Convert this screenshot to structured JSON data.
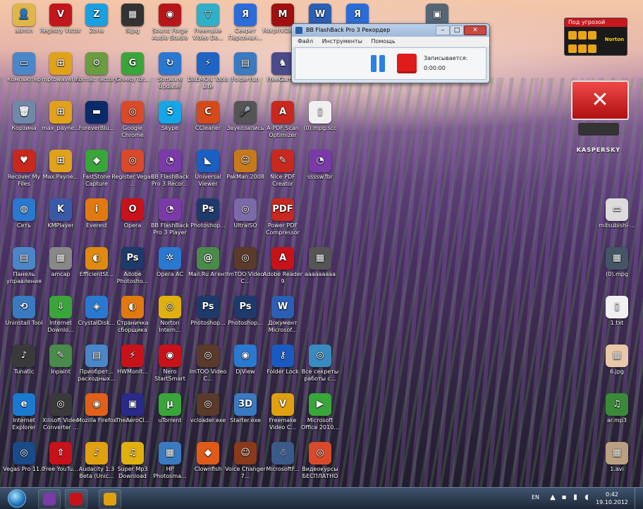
{
  "desktop": {
    "icons": [
      {
        "label": "admin",
        "glyph": "👤",
        "color": "#e0b64a"
      },
      {
        "label": "Registry Victor",
        "glyph": "V",
        "color": "#c2161c"
      },
      {
        "label": "Zona",
        "glyph": "Z",
        "color": "#1aa0e0"
      },
      {
        "label": "Sljpg",
        "glyph": "▦",
        "color": "#333333"
      },
      {
        "label": "Sound Forge Audio Studio",
        "glyph": "◉",
        "color": "#b8151b"
      },
      {
        "label": "Freemake Video Do...",
        "glyph": "▽",
        "color": "#2fb0c8"
      },
      {
        "label": "Секрет Персонал...",
        "glyph": "Я",
        "color": "#2c6cd8"
      },
      {
        "label": "MorphVOX Pro",
        "glyph": "M",
        "color": "#a01010"
      },
      {
        "label": "(1).doc",
        "glyph": "W",
        "color": "#2b5fb5"
      },
      {
        "label": "ЯТ",
        "glyph": "Я",
        "color": "#2c6cd8"
      },
      {
        "label": "1 - Copy",
        "glyph": "▣",
        "color": "#556677"
      },
      {
        "label": "Компьютер",
        "glyph": "▭",
        "color": "#4a86c8"
      },
      {
        "label": "mpfbwaverat",
        "glyph": "⊞",
        "color": "#e0a21b"
      },
      {
        "label": "Format Factory",
        "glyph": "⚙",
        "color": "#6a9c40"
      },
      {
        "label": "GreedyTor...",
        "glyph": "G",
        "color": "#3aa53a"
      },
      {
        "label": "Software Updater",
        "glyph": "↻",
        "color": "#2a79d0"
      },
      {
        "label": "DAEMON Tools Lite",
        "glyph": "⚡",
        "color": "#1f64c4"
      },
      {
        "label": "FolderFun",
        "glyph": "▤",
        "color": "#3a7ac0"
      },
      {
        "label": "FreeGames",
        "glyph": "♞",
        "color": "#4b4b8a"
      },
      {
        "label": "Корзина",
        "glyph": "🗑",
        "color": "#6f8aa8"
      },
      {
        "label": "max_payne...",
        "glyph": "⊞",
        "color": "#e0a21b"
      },
      {
        "label": "ForeverBlu...",
        "glyph": "▬",
        "color": "#0a2a6a"
      },
      {
        "label": "Google Chrome",
        "glyph": "◎",
        "color": "#d94a2b"
      },
      {
        "label": "Skype",
        "glyph": "S",
        "color": "#13a7e8"
      },
      {
        "label": "CCleaner",
        "glyph": "C",
        "color": "#d54a1a"
      },
      {
        "label": "Звукозапись",
        "glyph": "🎤",
        "color": "#555555"
      },
      {
        "label": "A-PDF Scan Optimizer",
        "glyph": "A",
        "color": "#c8281e"
      },
      {
        "label": "(0).mpg.scc",
        "glyph": "▯",
        "color": "#f0f0f0"
      },
      {
        "label": "Recover My Files",
        "glyph": "♥",
        "color": "#c8281e"
      },
      {
        "label": "Max.Payne...",
        "glyph": "⊞",
        "color": "#e0a21b"
      },
      {
        "label": "FastStone Capture",
        "glyph": "◆",
        "color": "#3aa53a"
      },
      {
        "label": "Register Vegas ...",
        "glyph": "◎",
        "color": "#d94a2b"
      },
      {
        "label": "BB FlashBack Pro 3 Recor...",
        "glyph": "◔",
        "color": "#7a3aa8"
      },
      {
        "label": "Universal Viewer",
        "glyph": "◣",
        "color": "#1a60c0"
      },
      {
        "label": "PakMan 2008",
        "glyph": "☺",
        "color": "#c87a1a"
      },
      {
        "label": "Nice PDF Creator",
        "glyph": "✎",
        "color": "#c8281e"
      },
      {
        "label": "ssssw.fbr",
        "glyph": "◔",
        "color": "#7a3aa8"
      },
      {
        "label": "Сеть",
        "glyph": "◍",
        "color": "#2a79d0"
      },
      {
        "label": "KMPlayer",
        "glyph": "K",
        "color": "#3a5aa8"
      },
      {
        "label": "Everest",
        "glyph": "i",
        "color": "#e07a10"
      },
      {
        "label": "Opera",
        "glyph": "O",
        "color": "#c8121a"
      },
      {
        "label": "BB FlashBack Pro 3 Player",
        "glyph": "◔",
        "color": "#7a3aa8"
      },
      {
        "label": "Photoshop...",
        "glyph": "Ps",
        "color": "#1e3a6a"
      },
      {
        "label": "UltraISO",
        "glyph": "◎",
        "color": "#7a6aa8"
      },
      {
        "label": "Power PDF Compressor",
        "glyph": "PDF",
        "color": "#c8281e"
      },
      {
        "label": "mitsubishi-...",
        "glyph": "▭",
        "color": "#dcdcdc"
      },
      {
        "label": "Панель управления",
        "glyph": "▤",
        "color": "#4a86c8"
      },
      {
        "label": "amcap",
        "glyph": "▦",
        "color": "#888888"
      },
      {
        "label": "EfficientSt...",
        "glyph": "◐",
        "color": "#e08a10"
      },
      {
        "label": "Adobe Photosho...",
        "glyph": "Ps",
        "color": "#1e3a6a"
      },
      {
        "label": "Opera AC",
        "glyph": "✲",
        "color": "#2a79d0"
      },
      {
        "label": "Mail.Ru Агент",
        "glyph": "@",
        "color": "#4a8a4a"
      },
      {
        "label": "ImTOO Video C...",
        "glyph": "◎",
        "color": "#5a3a2a"
      },
      {
        "label": "Adobe Reader 9",
        "glyph": "A",
        "color": "#c8121a"
      },
      {
        "label": "ааааааааа",
        "glyph": "▦",
        "color": "#555555"
      },
      {
        "label": "(0).mpg",
        "glyph": "▦",
        "color": "#445566"
      },
      {
        "label": "Uninstall Tool",
        "glyph": "⟲",
        "color": "#3a7ac0"
      },
      {
        "label": "Internet Downlo...",
        "glyph": "⇩",
        "color": "#3aa53a"
      },
      {
        "label": "CrystalDisk...",
        "glyph": "◈",
        "color": "#2a79d0"
      },
      {
        "label": "Страничка сборщика",
        "glyph": "◐",
        "color": "#e07a10"
      },
      {
        "label": "Norton Intern...",
        "glyph": "◎",
        "color": "#e0b010"
      },
      {
        "label": "Photoshop...",
        "glyph": "Ps",
        "color": "#1e3a6a"
      },
      {
        "label": "Photoshop...",
        "glyph": "Ps",
        "color": "#1e3a6a"
      },
      {
        "label": "Документ Microsof...",
        "glyph": "W",
        "color": "#2b5fb5"
      },
      {
        "label": "1.txt",
        "glyph": "▯",
        "color": "#f0f0f0"
      },
      {
        "label": "Tunatic",
        "glyph": "♪",
        "color": "#3a3a3a"
      },
      {
        "label": "Inpaint",
        "glyph": "✎",
        "color": "#4a8a4a"
      },
      {
        "label": "Приобрет... расходных...",
        "glyph": "▤",
        "color": "#4a86c8"
      },
      {
        "label": "HWMonit...",
        "glyph": "⚡",
        "color": "#c8121a"
      },
      {
        "label": "Nero StartSmart",
        "glyph": "◉",
        "color": "#c8121a"
      },
      {
        "label": "ImTOO Video C...",
        "glyph": "◎",
        "color": "#5a3a2a"
      },
      {
        "label": "DjView",
        "glyph": "◉",
        "color": "#2a79d0"
      },
      {
        "label": "Folder Lock",
        "glyph": "⚷",
        "color": "#1a5ac0"
      },
      {
        "label": "Все секреты работы с...",
        "glyph": "◎",
        "color": "#3a8ac0"
      },
      {
        "label": "6.jpg",
        "glyph": "▦",
        "color": "#e8c8a8"
      },
      {
        "label": "Internet Explorer",
        "glyph": "e",
        "color": "#1a7ad0"
      },
      {
        "label": "Xilisoft Video Converter ...",
        "glyph": "◎",
        "color": "#3a3a3a"
      },
      {
        "label": "Mozilla Firefox",
        "glyph": "◉",
        "color": "#e0601a"
      },
      {
        "label": "TheAeroCl...",
        "glyph": "▣",
        "color": "#2a2a8a"
      },
      {
        "label": "uTorrent",
        "glyph": "µ",
        "color": "#3aa53a"
      },
      {
        "label": "vcloader.exe",
        "glyph": "◎",
        "color": "#5a3a2a"
      },
      {
        "label": "Starter.exe",
        "glyph": "3D",
        "color": "#3a7ac0"
      },
      {
        "label": "Freemake Video C...",
        "glyph": "V",
        "color": "#e0a010"
      },
      {
        "label": "Microsoft Office 2010...",
        "glyph": "▶",
        "color": "#3aa53a"
      },
      {
        "label": "ar.mp3",
        "glyph": "♫",
        "color": "#3a8a3a"
      },
      {
        "label": "Vegas Pro 11.0",
        "glyph": "◎",
        "color": "#1a4a8a"
      },
      {
        "label": "Free YouTu...",
        "glyph": "⇧",
        "color": "#c8121a"
      },
      {
        "label": "Audacity 1.3 Beta (Unic...",
        "glyph": "♪",
        "color": "#e0a010"
      },
      {
        "label": "Super Mp3 Download",
        "glyph": "♫",
        "color": "#e0b010"
      },
      {
        "label": "HP Photosma...",
        "glyph": "▦",
        "color": "#3a7ac0"
      },
      {
        "label": "Clownfish",
        "glyph": "◆",
        "color": "#e05a1a"
      },
      {
        "label": "Voice Changer 7...",
        "glyph": "☺",
        "color": "#8a3a1a"
      },
      {
        "label": "MicrosoftF...",
        "glyph": "☃",
        "color": "#3a5a8a"
      },
      {
        "label": "Видеокурсы БЕСПЛАТНО",
        "glyph": "◎",
        "color": "#d94a2b"
      },
      {
        "label": "1.avi",
        "glyph": "▦",
        "color": "#bba080"
      }
    ]
  },
  "recorder": {
    "title": "BB FlashBack Pro 3 Рекордер",
    "menu": [
      "Файл",
      "Инструменты",
      "Помощь"
    ],
    "recording_label": "Записывается:",
    "recording_time": "0:00:00"
  },
  "norton": {
    "status": "Под угрозой",
    "logo": "Norton"
  },
  "kaspersky": {
    "brand": "KASPERSKY"
  },
  "taskbar": {
    "lang": "EN",
    "time": "0:42",
    "date": "19.10.2012"
  }
}
